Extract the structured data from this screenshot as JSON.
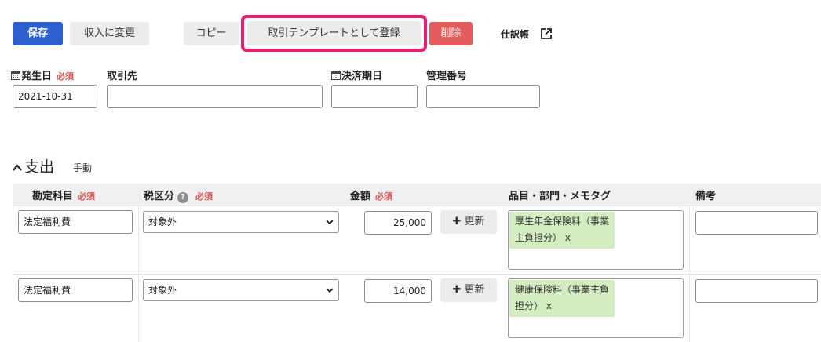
{
  "toolbar": {
    "save": "保存",
    "change_to_income": "収入に変更",
    "copy": "コピー",
    "register_template": "取引テンプレートとして登録",
    "delete": "削除",
    "journal": "仕訳帳"
  },
  "form": {
    "issue_date_label": "発生日",
    "required": "必須",
    "issue_date_value": "2021-10-31",
    "partner_label": "取引先",
    "partner_value": "",
    "settlement_date_label": "決済期日",
    "settlement_date_value": "",
    "management_number_label": "管理番号",
    "management_number_value": ""
  },
  "section": {
    "title": "支出",
    "mode": "手動"
  },
  "table": {
    "headers": {
      "account": "勘定科目",
      "tax": "税区分",
      "amount": "金額",
      "items": "品目・部門・メモタグ",
      "note": "備考"
    },
    "update_label": "更新",
    "rows": [
      {
        "account": "法定福利費",
        "tax": "対象外",
        "amount": "25,000",
        "tag": "厚生年金保険料（事業主負担分） x",
        "note": ""
      },
      {
        "account": "法定福利費",
        "tax": "対象外",
        "amount": "14,000",
        "tag": "健康保険料（事業主負担分） x",
        "note": ""
      }
    ]
  },
  "colors": {
    "primary": "#2d5fcf",
    "danger": "#e45c5c",
    "highlight": "#ea1c74",
    "tag_bg": "#d3ecc0",
    "required": "#d9534f"
  }
}
